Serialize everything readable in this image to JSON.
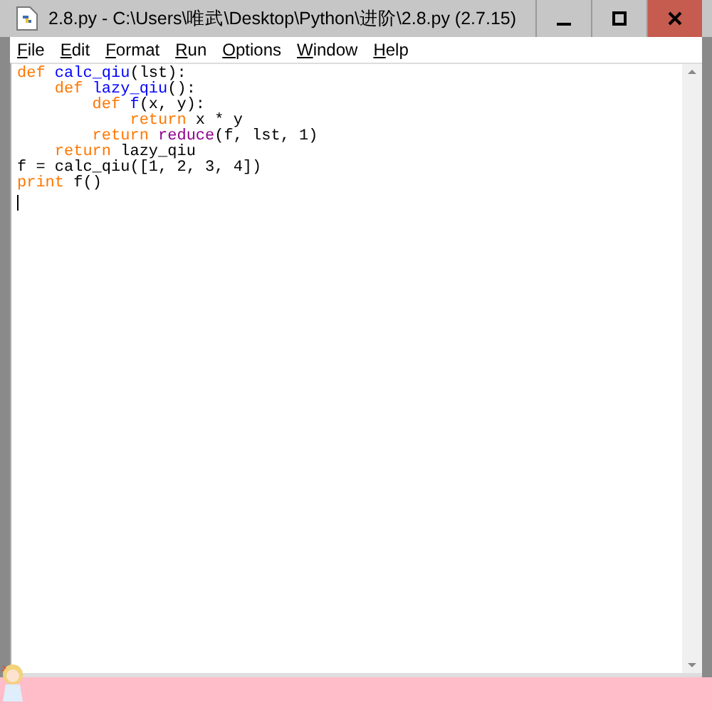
{
  "window": {
    "title": "2.8.py - C:\\Users\\唯武\\Desktop\\Python\\进阶\\2.8.py (2.7.15)"
  },
  "menu": [
    {
      "label": "File"
    },
    {
      "label": "Edit"
    },
    {
      "label": "Format"
    },
    {
      "label": "Run"
    },
    {
      "label": "Options"
    },
    {
      "label": "Window"
    },
    {
      "label": "Help"
    }
  ],
  "editor": {
    "lines": [
      [
        {
          "t": "def",
          "kind": "keyword"
        },
        {
          "t": " calc_qiu",
          "kind": "definition"
        },
        {
          "t": "(lst):",
          "kind": "plain"
        }
      ],
      [
        {
          "t": "    def",
          "kind": "keyword"
        },
        {
          "t": " lazy_qiu",
          "kind": "definition"
        },
        {
          "t": "():",
          "kind": "plain"
        }
      ],
      [
        {
          "t": "        def",
          "kind": "keyword"
        },
        {
          "t": " f",
          "kind": "definition"
        },
        {
          "t": "(x, y):",
          "kind": "plain"
        }
      ],
      [
        {
          "t": "            return",
          "kind": "keyword"
        },
        {
          "t": " x * y",
          "kind": "plain"
        }
      ],
      [
        {
          "t": "        return",
          "kind": "keyword"
        },
        {
          "t": " reduce",
          "kind": "builtin"
        },
        {
          "t": "(f, lst, 1)",
          "kind": "plain"
        }
      ],
      [
        {
          "t": "    return",
          "kind": "keyword"
        },
        {
          "t": " lazy_qiu",
          "kind": "plain"
        }
      ],
      [
        {
          "t": "f = calc_qiu([1, 2, 3, 4])",
          "kind": "plain"
        }
      ],
      [
        {
          "t": "print",
          "kind": "keyword"
        },
        {
          "t": " f()",
          "kind": "plain"
        }
      ]
    ]
  }
}
